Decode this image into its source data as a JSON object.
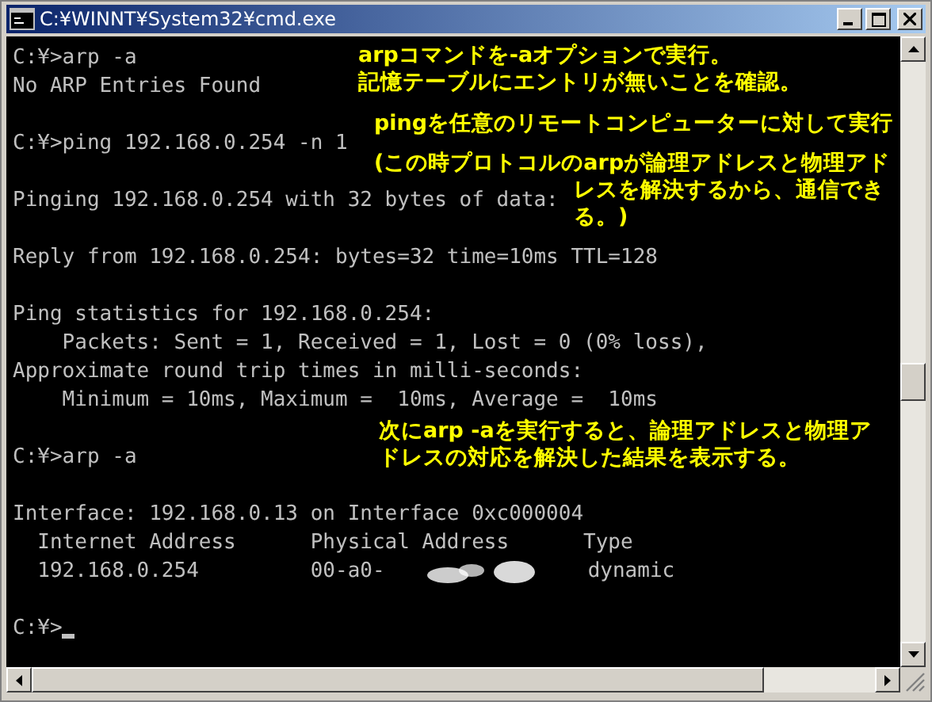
{
  "window": {
    "title": "C:¥WINNT¥System32¥cmd.exe"
  },
  "console": {
    "lines": [
      {
        "kind": "text",
        "text": "C:¥>arp -a"
      },
      {
        "kind": "text",
        "text": "No ARP Entries Found"
      },
      {
        "kind": "blank"
      },
      {
        "kind": "text",
        "text": "C:¥>ping 192.168.0.254 -n 1"
      },
      {
        "kind": "blank"
      },
      {
        "kind": "text",
        "text": "Pinging 192.168.0.254 with 32 bytes of data:"
      },
      {
        "kind": "blank"
      },
      {
        "kind": "text",
        "text": "Reply from 192.168.0.254: bytes=32 time=10ms TTL=128"
      },
      {
        "kind": "blank"
      },
      {
        "kind": "text",
        "text": "Ping statistics for 192.168.0.254:"
      },
      {
        "kind": "text",
        "text": "    Packets: Sent = 1, Received = 1, Lost = 0 (0% loss),"
      },
      {
        "kind": "text",
        "text": "Approximate round trip times in milli-seconds:"
      },
      {
        "kind": "text",
        "text": "    Minimum = 10ms, Maximum =  10ms, Average =  10ms"
      },
      {
        "kind": "blank"
      },
      {
        "kind": "text",
        "text": "C:¥>arp -a"
      },
      {
        "kind": "blank"
      },
      {
        "kind": "text",
        "text": "Interface: 192.168.0.13 on Interface 0xc000004"
      },
      {
        "kind": "text",
        "text": "  Internet Address      Physical Address      Type"
      },
      {
        "kind": "redacted",
        "before": "  192.168.0.254         00-a0-",
        "after": "dynamic"
      },
      {
        "kind": "blank"
      },
      {
        "kind": "prompt",
        "text": "C:¥>"
      }
    ]
  },
  "annotations": [
    {
      "lines": [
        "arpコマンドを-aオプションで実行。",
        "記憶テーブルにエントリが無いことを確認。"
      ]
    },
    {
      "lines": [
        "pingを任意のリモートコンピューターに対して実行"
      ]
    },
    {
      "lines": [
        "(この時プロトコルのarpが論理アドレスと物理アド"
      ]
    },
    {
      "lines": [
        "レスを解決するから、通信でき",
        "る。)"
      ]
    },
    {
      "lines": [
        "次にarp -aを実行すると、論理アドレスと物理ア",
        "ドレスの対応を解決した結果を表示する。"
      ]
    }
  ]
}
